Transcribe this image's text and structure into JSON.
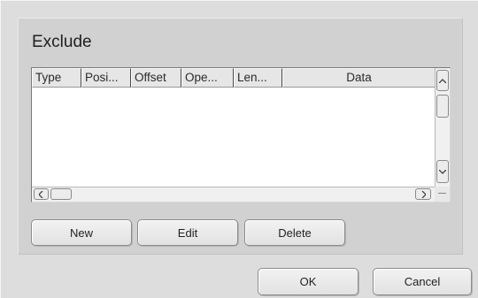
{
  "group": {
    "title": "Exclude"
  },
  "table": {
    "columns": [
      "Type",
      "Posi...",
      "Offset",
      "Ope...",
      "Len...",
      "Data"
    ],
    "rows": []
  },
  "scrollbars": {
    "up_icon": "chevron-up-icon",
    "down_icon": "chevron-down-icon",
    "left_icon": "chevron-left-icon",
    "right_icon": "chevron-right-icon"
  },
  "buttons": {
    "new": "New",
    "edit": "Edit",
    "delete": "Delete",
    "ok": "OK",
    "cancel": "Cancel"
  }
}
